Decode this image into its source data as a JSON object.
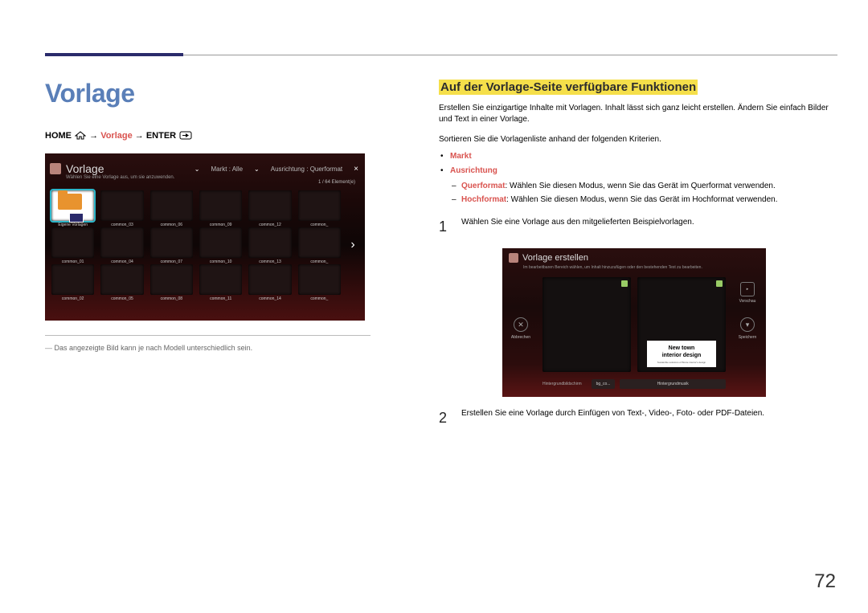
{
  "page_number": "72",
  "title": "Vorlage",
  "breadcrumb": {
    "home": "HOME",
    "vorlage": "Vorlage",
    "enter": "ENTER",
    "arrow": "→"
  },
  "screenshot1": {
    "title": "Vorlage",
    "subtitle": "Wählen Sie eine Vorlage aus, um sie anzuwenden.",
    "filter_market_label": "Markt :",
    "filter_market_value": "Alle",
    "filter_orient_label": "Ausrichtung :",
    "filter_orient_value": "Querformat",
    "count": "1 / 64 Element(e)",
    "highlight_label": "Eigene Vorlagen",
    "cells_row1": [
      "Eigene Vorlagen",
      "common_03",
      "common_06",
      "common_09",
      "common_12",
      "common_"
    ],
    "cells_row2": [
      "common_01",
      "common_04",
      "common_07",
      "common_10",
      "common_13",
      "common_"
    ],
    "cells_row3": [
      "common_02",
      "common_05",
      "common_08",
      "common_11",
      "common_14",
      "common_"
    ]
  },
  "caption": "Das angezeigte Bild kann je nach Modell unterschiedlich sein.",
  "section_heading": "Auf der Vorlage-Seite verfügbare Funktionen",
  "para1": "Erstellen Sie einzigartige Inhalte mit Vorlagen. Inhalt lässt sich ganz leicht erstellen. Ändern Sie einfach Bilder und Text in einer Vorlage.",
  "para2": "Sortieren Sie die Vorlagenliste anhand der folgenden Kriterien.",
  "bullets": {
    "markt": "Markt",
    "ausrichtung": "Ausrichtung"
  },
  "subbullets": {
    "quer_label": "Querformat",
    "quer_text": ": Wählen Sie diesen Modus, wenn Sie das Gerät im Querformat verwenden.",
    "hoch_label": "Hochformat",
    "hoch_text": ": Wählen Sie diesen Modus, wenn Sie das Gerät im Hochformat verwenden."
  },
  "steps": {
    "one_num": "1",
    "one_text": "Wählen Sie eine Vorlage aus den mitgelieferten Beispielvorlagen.",
    "two_num": "2",
    "two_text": "Erstellen Sie eine Vorlage durch Einfügen von Text-, Video-, Foto- oder PDF-Dateien."
  },
  "screenshot2": {
    "title": "Vorlage erstellen",
    "subtitle": "Im bearbeitbaren Bereich wählen, um Inhalt hinzuzufügen oder den bestehenden Text zu bearbeiten.",
    "left_btn": "Abbrechen",
    "right_preview": "Vorschau",
    "right_save": "Speichern",
    "textbox_l1": "New town",
    "textbox_l2": "interior design",
    "textbox_sm": "Sustainble solutions of Bonte interior's design",
    "bottom_label": "Hintergrundbildschirm",
    "bottom_box1": "bg_co...",
    "bottom_box2": "Hintergrundmusik"
  }
}
